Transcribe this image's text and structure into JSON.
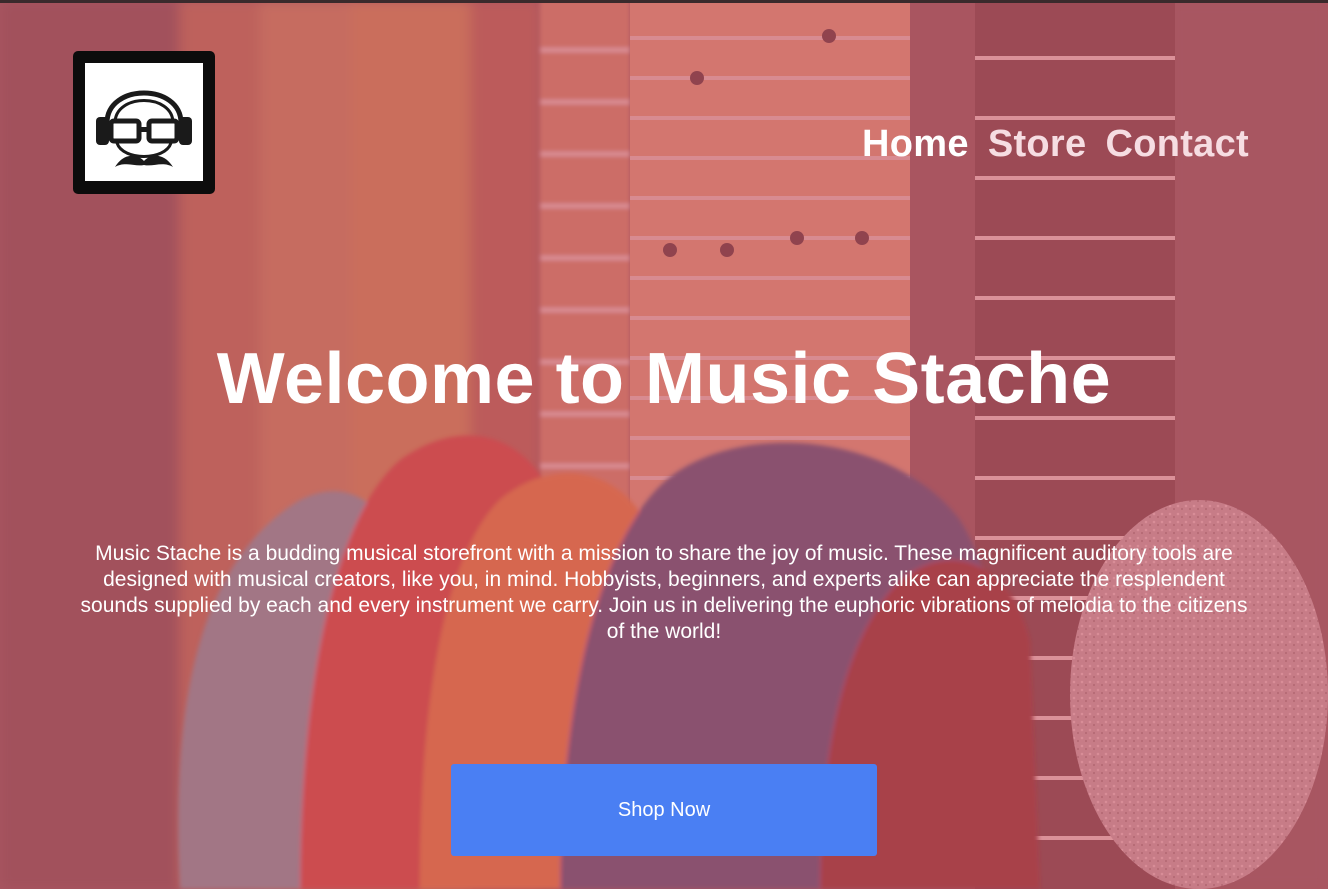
{
  "header": {
    "logo_alt": "Music Stache logo",
    "nav": [
      {
        "label": "Home"
      },
      {
        "label": "Store"
      },
      {
        "label": "Contact"
      }
    ]
  },
  "hero": {
    "title": "Welcome to Music Stache",
    "intro": "Music Stache is a budding musical storefront with a mission to share the joy of music. These magnificent auditory tools are designed with musical creators, like you, in mind. Hobbyists, beginners, and experts alike can appreciate the resplendent sounds supplied by each and every instrument we carry. Join us in delivering the euphoric vibrations of melodia to the citizens of the world!",
    "cta_label": "Shop Now",
    "background": "guitars-photo"
  },
  "colors": {
    "overlay": "#ce5c70",
    "cta": "#4a7ff3",
    "text": "#ffffff",
    "logo_frame": "#0c0c0c"
  }
}
